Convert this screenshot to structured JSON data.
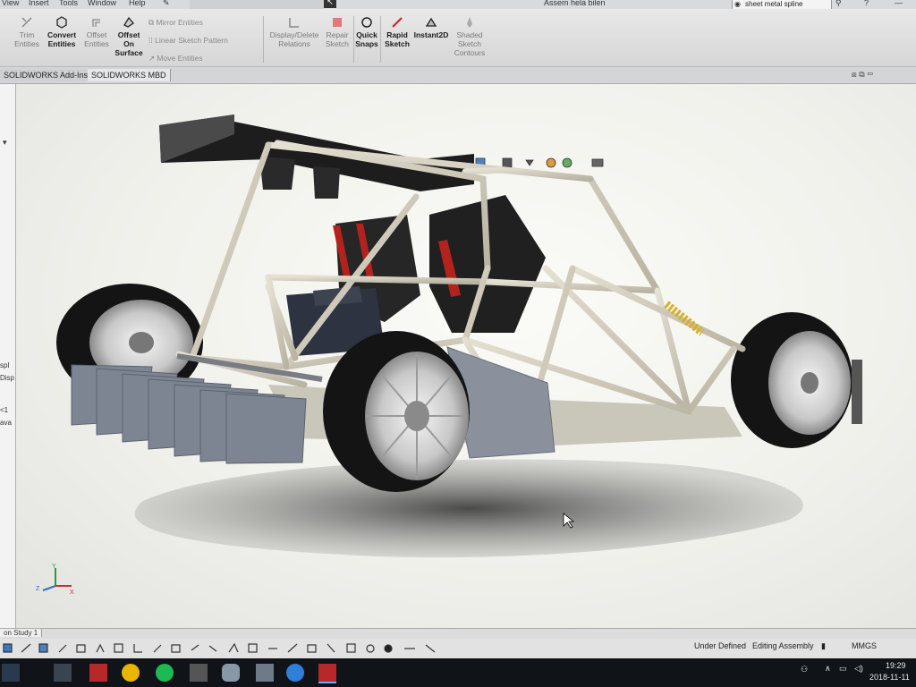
{
  "menu": [
    "View",
    "Insert",
    "Tools",
    "Window",
    "Help"
  ],
  "document_title": "Assem hela bilen",
  "search": {
    "value": "sheet metal spline"
  },
  "ribbon": {
    "trim_entities": "Trim Entities",
    "convert_entities": "Convert Entities",
    "offset_entities": "Offset Entities",
    "offset_on_surface": "Offset On Surface",
    "mirror_entities": "Mirror Entities",
    "linear_sketch_pattern": "Linear Sketch Pattern",
    "move_entities": "Move Entities",
    "display_delete_relations": "Display/Delete Relations",
    "repair_sketch": "Repair Sketch",
    "quick_snaps": "Quick Snaps",
    "rapid_sketch": "Rapid Sketch",
    "instant2d": "Instant2D",
    "shaded_sketch_contours": "Shaded Sketch Contours"
  },
  "tabs": [
    "SOLIDWORKS Add-Ins",
    "SOLIDWORKS MBD"
  ],
  "left_panel_fragments": [
    "spl",
    "Disp",
    "<1",
    "ava"
  ],
  "bottom_tab": "on Study 1",
  "status": {
    "state": "Under Defined",
    "mode": "Editing Assembly",
    "units": "MMGS",
    "time": "19:29",
    "date": "2018-11-11"
  },
  "triad": {
    "x": "X",
    "y": "Y",
    "z": "Z"
  },
  "shadow_color": "#5a5b58",
  "accent_color": "#2f6fc9"
}
